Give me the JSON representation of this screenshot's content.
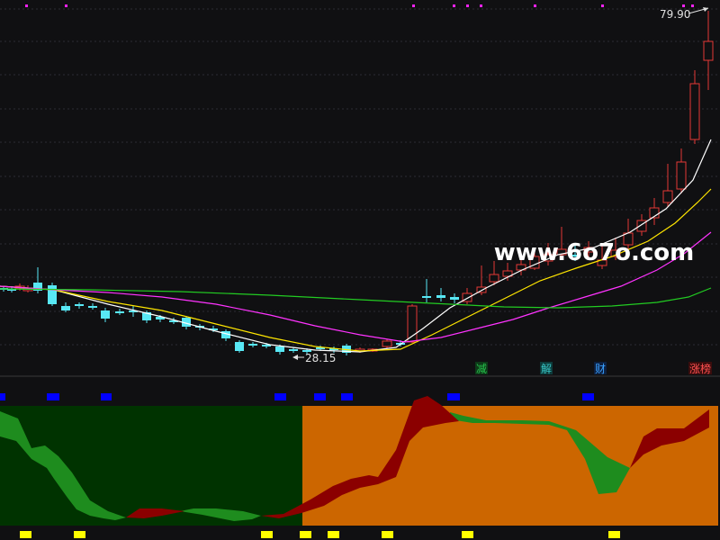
{
  "chart": {
    "price_high_label": "79.90",
    "price_low_label": "28.15",
    "watermark": "www.6o7o.com",
    "markers": [
      {
        "text": "减",
        "color": "#27c24c"
      },
      {
        "text": "解",
        "color": "#37c6c6"
      },
      {
        "text": "财",
        "color": "#3aa0ff"
      },
      {
        "text": "涨榜",
        "color": "#ff5050"
      }
    ],
    "colors": {
      "background": "#101012",
      "up": "#e53935",
      "down": "#58e8f5",
      "ma_fast": "#ffffff",
      "ma_mid": "#ffe600",
      "ma_slow": "#ff33ff",
      "ma_long": "#22cc22",
      "lower_bg_left": "#003300",
      "lower_bg_right": "#cc6600",
      "band_bull": "#1e8c1e",
      "band_bear": "#8b0000",
      "signal_blue": "#0000ff",
      "signal_yellow": "#ffff00",
      "signal_magenta": "#ff22ff"
    }
  }
}
